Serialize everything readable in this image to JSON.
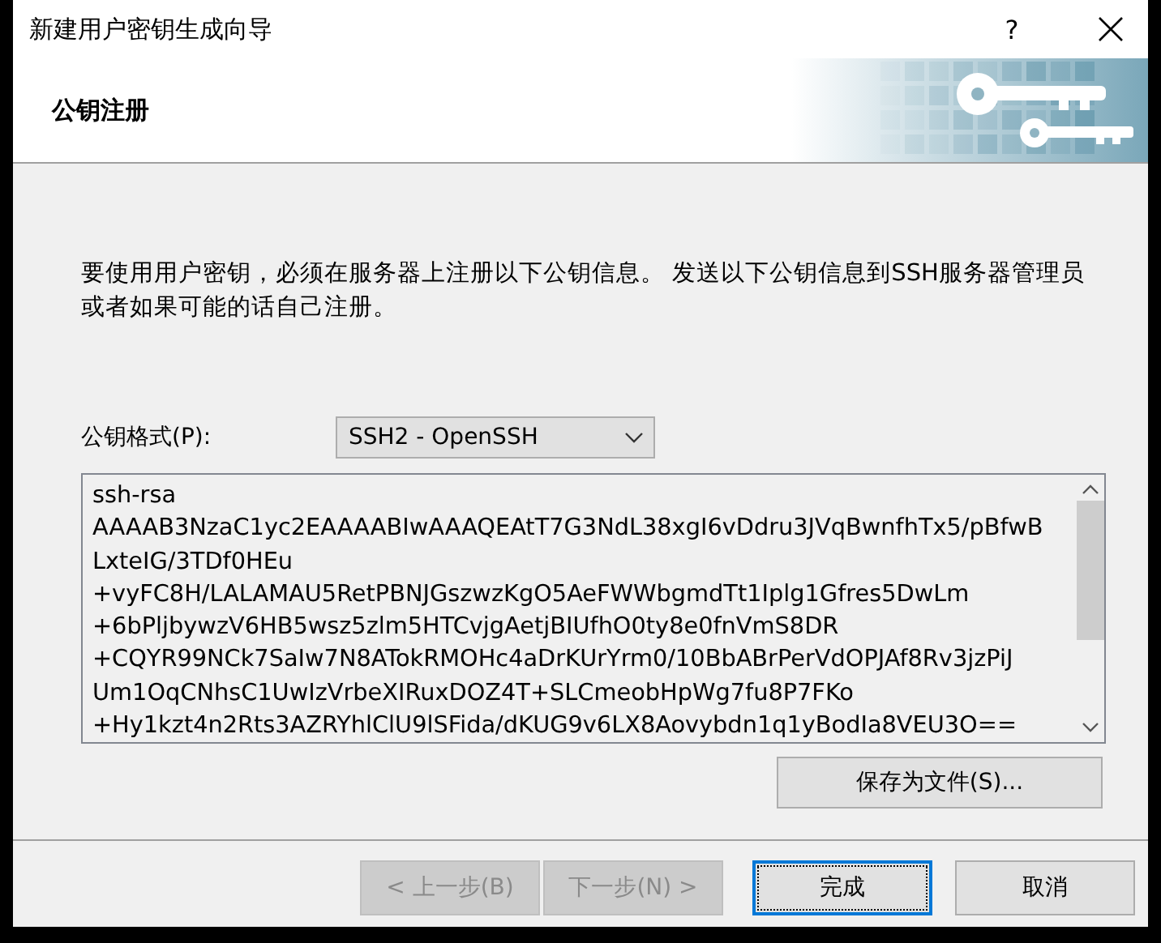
{
  "window": {
    "title": "新建用户密钥生成向导",
    "help": "?"
  },
  "page": {
    "title": "公钥注册"
  },
  "instructions": "要使用用户密钥，必须在服务器上注册以下公钥信息。 发送以下公钥信息到SSH服务器管理员或者如果可能的话自己注册。",
  "format": {
    "label": "公钥格式(P):",
    "value": "SSH2 - OpenSSH"
  },
  "public_key": {
    "lines": [
      "ssh-rsa",
      "AAAAB3NzaC1yc2EAAAABIwAAAQEAtT7G3NdL38xgI6vDdru3JVqBwnfhTx5/pBfwB",
      "LxteIG/3TDf0HEu",
      "+vyFC8H/LALAMAU5RetPBNJGszwzKgO5AeFWWbgmdTt1Iplg1Gfres5DwLm",
      "+6bPljbywzV6HB5wsz5zlm5HTCvjgAetjBIUfhO0ty8e0fnVmS8DR",
      "+CQYR99NCk7SaIw7N8ATokRMOHc4aDrKUrYrm0/10BbABrPerVdOPJAf8Rv3jzPiJ",
      "Um1OqCNhsC1UwIzVrbeXIRuxDOZ4T+SLCmeobHpWg7fu8P7FKo",
      "+Hy1kzt4n2Rts3AZRYhlClU9lSFida/dKUG9v6LX8Aovybdn1q1yBodIa8VEU3O=="
    ]
  },
  "save_button": {
    "label": "保存为文件(S)..."
  },
  "nav": [
    {
      "label": "< 上一步(B)",
      "disabled": true,
      "focused": false
    },
    {
      "label": "下一步(N) >",
      "disabled": true,
      "focused": false
    },
    {
      "label": "完成",
      "disabled": false,
      "focused": true
    },
    {
      "label": "取消",
      "disabled": false,
      "focused": false
    }
  ]
}
